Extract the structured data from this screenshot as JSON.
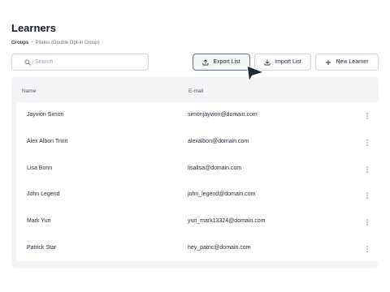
{
  "header": {
    "title": "Learners",
    "breadcrumb": {
      "parent": "Groups",
      "separator": "•",
      "current": "Pilates (Double Opt-in Group)"
    }
  },
  "toolbar": {
    "search_placeholder": "Search",
    "search_value": "",
    "export_label": "Export List",
    "import_label": "Import List",
    "add_label": "New Learner"
  },
  "table": {
    "columns": [
      "Name",
      "E-mail"
    ],
    "rows": [
      {
        "name": "Jayvion Simon",
        "email": "simonjayvion@domain.com"
      },
      {
        "name": "Alex Albon Trinit",
        "email": "alexalbon@domain.com"
      },
      {
        "name": "Lisa Bonn",
        "email": "lisalisa@domain.com"
      },
      {
        "name": "John Legend",
        "email": "john_legend@domain.com"
      },
      {
        "name": "Mark Yuri",
        "email": "yuri_mark13324@domain.com"
      },
      {
        "name": "Patrick Star",
        "email": "hey_patric@domain.com"
      }
    ]
  },
  "icons": {
    "search": "search-icon",
    "export": "upload-icon",
    "import": "download-icon",
    "add": "plus-icon",
    "row_menu": "kebab-menu-icon",
    "cursor": "mouse-pointer-icon"
  },
  "colors": {
    "panel_bg": "#f3f4f6",
    "border": "#d1d5db",
    "title": "#111827",
    "export_border": "#64748b"
  }
}
